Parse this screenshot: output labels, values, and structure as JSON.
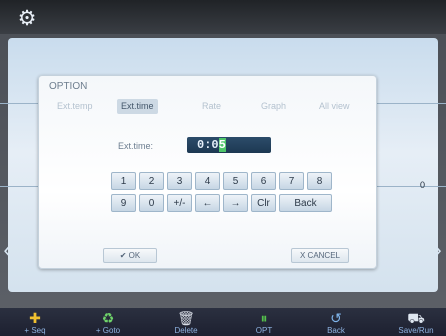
{
  "dialog": {
    "title": "OPTION",
    "tabs": [
      "Ext.temp",
      "Ext.time",
      "Rate",
      "Graph",
      "All view"
    ],
    "active_tab": "Ext.time",
    "field_label": "Ext.time:",
    "field_value_prefix": "0:0",
    "field_value_cursor": "5",
    "keys_row1": [
      "1",
      "2",
      "3",
      "4",
      "5",
      "6",
      "7",
      "8"
    ],
    "keys_row2": [
      "9",
      "0",
      "+/-",
      "←",
      "→",
      "Clr",
      "Back"
    ],
    "ok_label": "✔ OK",
    "cancel_label": "X CANCEL"
  },
  "side": {
    "value": "0"
  },
  "toolbar": {
    "items": [
      {
        "label": "+ Seq",
        "icon": "add-sequence-icon"
      },
      {
        "label": "+ Goto",
        "icon": "goto-icon"
      },
      {
        "label": "Delete",
        "icon": "trash-icon"
      },
      {
        "label": "OPT",
        "icon": "pause-icon"
      },
      {
        "label": "Back",
        "icon": "back-icon"
      },
      {
        "label": "Save/Run",
        "icon": "save-run-icon"
      }
    ]
  },
  "colors": {
    "accent_green": "#4fc66a",
    "display_bg": "#1d3852",
    "toolbar_bg": "#1d2030"
  }
}
